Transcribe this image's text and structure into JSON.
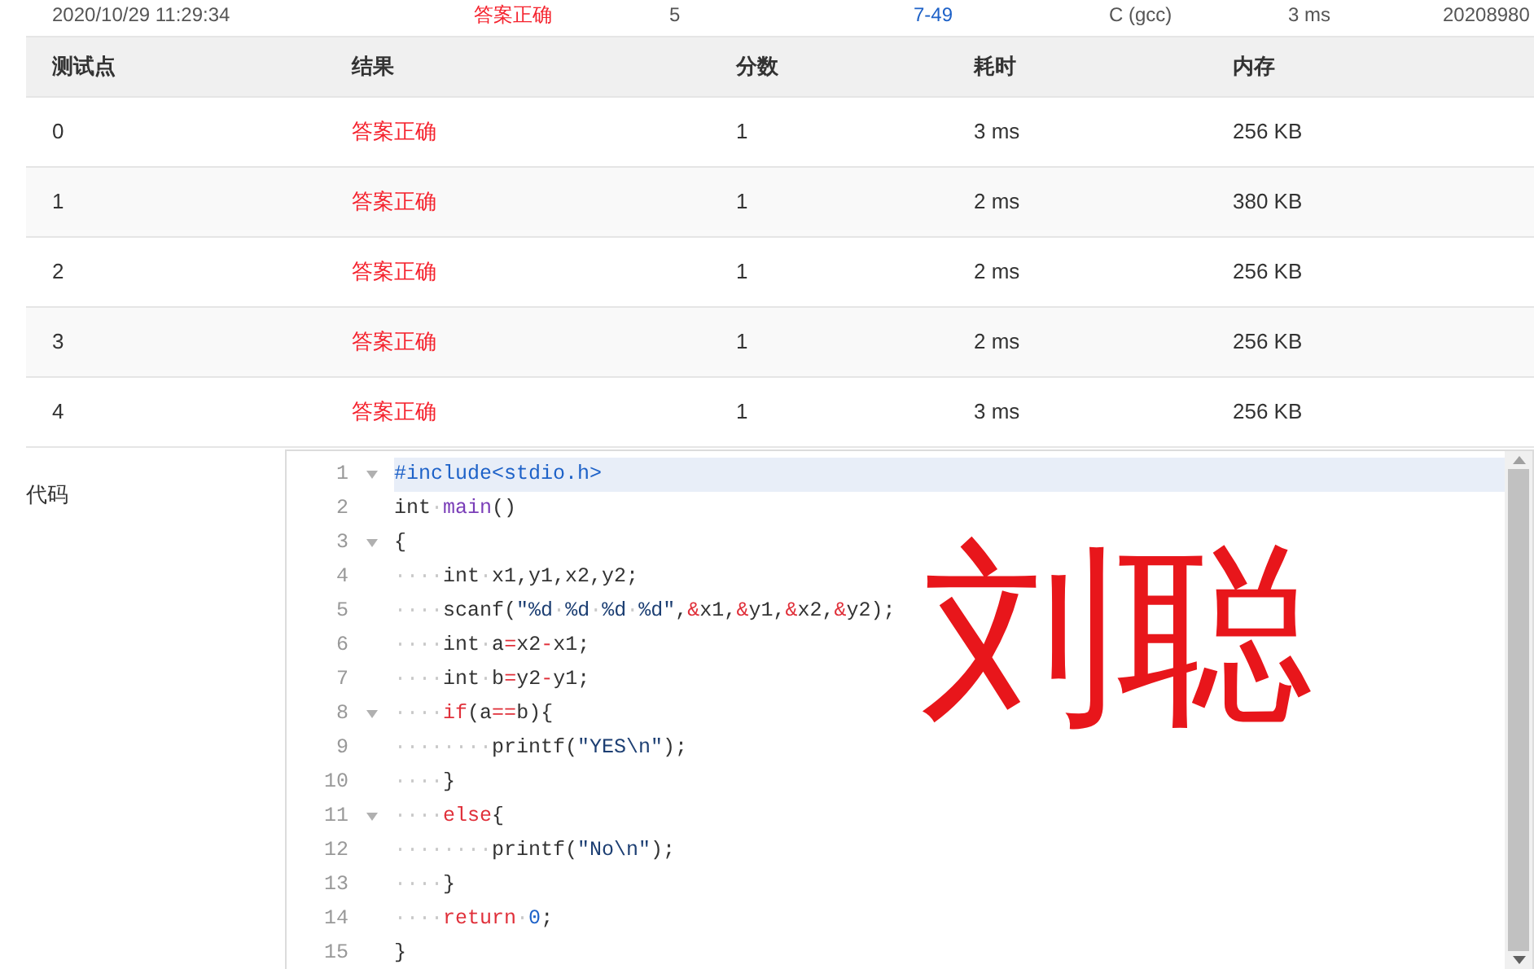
{
  "submission_row": {
    "time": "2020/10/29 11:29:34",
    "result": "答案正确",
    "score": "5",
    "problem": "7-49",
    "compiler": "C (gcc)",
    "duration": "3 ms",
    "user": "20208980"
  },
  "table": {
    "columns": [
      "测试点",
      "结果",
      "分数",
      "耗时",
      "内存"
    ],
    "rows": [
      {
        "case": "0",
        "result": "答案正确",
        "score": "1",
        "time": "3 ms",
        "memory": "256 KB"
      },
      {
        "case": "1",
        "result": "答案正确",
        "score": "1",
        "time": "2 ms",
        "memory": "380 KB"
      },
      {
        "case": "2",
        "result": "答案正确",
        "score": "1",
        "time": "2 ms",
        "memory": "256 KB"
      },
      {
        "case": "3",
        "result": "答案正确",
        "score": "1",
        "time": "2 ms",
        "memory": "256 KB"
      },
      {
        "case": "4",
        "result": "答案正确",
        "score": "1",
        "time": "3 ms",
        "memory": "256 KB"
      }
    ]
  },
  "code": {
    "label": "代码",
    "annotation": "刘聪",
    "lines": [
      {
        "number": "1",
        "fold": true,
        "current": true,
        "tokens": [
          {
            "kind": "meta",
            "text": "#include<stdio.h>"
          }
        ]
      },
      {
        "number": "2",
        "fold": false,
        "current": false,
        "tokens": [
          {
            "kind": "plain",
            "text": "int"
          },
          {
            "kind": "ws",
            "text": "·"
          },
          {
            "kind": "func",
            "text": "main"
          },
          {
            "kind": "plain",
            "text": "()"
          }
        ]
      },
      {
        "number": "3",
        "fold": true,
        "current": false,
        "tokens": [
          {
            "kind": "plain",
            "text": "{"
          }
        ]
      },
      {
        "number": "4",
        "fold": false,
        "current": false,
        "tokens": [
          {
            "kind": "ws",
            "text": "····"
          },
          {
            "kind": "plain",
            "text": "int"
          },
          {
            "kind": "ws",
            "text": "·"
          },
          {
            "kind": "plain",
            "text": "x1,y1,x2,y2;"
          }
        ]
      },
      {
        "number": "5",
        "fold": false,
        "current": false,
        "tokens": [
          {
            "kind": "ws",
            "text": "····"
          },
          {
            "kind": "plain",
            "text": "scanf("
          },
          {
            "kind": "string",
            "text": "\"%d"
          },
          {
            "kind": "ws",
            "text": "·"
          },
          {
            "kind": "string",
            "text": "%d"
          },
          {
            "kind": "ws",
            "text": "·"
          },
          {
            "kind": "string",
            "text": "%d"
          },
          {
            "kind": "ws",
            "text": "·"
          },
          {
            "kind": "string",
            "text": "%d\""
          },
          {
            "kind": "plain",
            "text": ","
          },
          {
            "kind": "op",
            "text": "&"
          },
          {
            "kind": "plain",
            "text": "x1,"
          },
          {
            "kind": "op",
            "text": "&"
          },
          {
            "kind": "plain",
            "text": "y1,"
          },
          {
            "kind": "op",
            "text": "&"
          },
          {
            "kind": "plain",
            "text": "x2,"
          },
          {
            "kind": "op",
            "text": "&"
          },
          {
            "kind": "plain",
            "text": "y2);"
          }
        ]
      },
      {
        "number": "6",
        "fold": false,
        "current": false,
        "tokens": [
          {
            "kind": "ws",
            "text": "····"
          },
          {
            "kind": "plain",
            "text": "int"
          },
          {
            "kind": "ws",
            "text": "·"
          },
          {
            "kind": "plain",
            "text": "a"
          },
          {
            "kind": "op",
            "text": "="
          },
          {
            "kind": "plain",
            "text": "x2"
          },
          {
            "kind": "op",
            "text": "-"
          },
          {
            "kind": "plain",
            "text": "x1;"
          }
        ]
      },
      {
        "number": "7",
        "fold": false,
        "current": false,
        "tokens": [
          {
            "kind": "ws",
            "text": "····"
          },
          {
            "kind": "plain",
            "text": "int"
          },
          {
            "kind": "ws",
            "text": "·"
          },
          {
            "kind": "plain",
            "text": "b"
          },
          {
            "kind": "op",
            "text": "="
          },
          {
            "kind": "plain",
            "text": "y2"
          },
          {
            "kind": "op",
            "text": "-"
          },
          {
            "kind": "plain",
            "text": "y1;"
          }
        ]
      },
      {
        "number": "8",
        "fold": true,
        "current": false,
        "tokens": [
          {
            "kind": "ws",
            "text": "····"
          },
          {
            "kind": "keyword",
            "text": "if"
          },
          {
            "kind": "plain",
            "text": "(a"
          },
          {
            "kind": "op",
            "text": "=="
          },
          {
            "kind": "plain",
            "text": "b){"
          }
        ]
      },
      {
        "number": "9",
        "fold": false,
        "current": false,
        "tokens": [
          {
            "kind": "ws",
            "text": "········"
          },
          {
            "kind": "plain",
            "text": "printf("
          },
          {
            "kind": "string",
            "text": "\"YES\\n\""
          },
          {
            "kind": "plain",
            "text": ");"
          }
        ]
      },
      {
        "number": "10",
        "fold": false,
        "current": false,
        "tokens": [
          {
            "kind": "ws",
            "text": "····"
          },
          {
            "kind": "plain",
            "text": "}"
          }
        ]
      },
      {
        "number": "11",
        "fold": true,
        "current": false,
        "tokens": [
          {
            "kind": "ws",
            "text": "····"
          },
          {
            "kind": "keyword",
            "text": "else"
          },
          {
            "kind": "plain",
            "text": "{"
          }
        ]
      },
      {
        "number": "12",
        "fold": false,
        "current": false,
        "tokens": [
          {
            "kind": "ws",
            "text": "········"
          },
          {
            "kind": "plain",
            "text": "printf("
          },
          {
            "kind": "string",
            "text": "\"No\\n\""
          },
          {
            "kind": "plain",
            "text": ");"
          }
        ]
      },
      {
        "number": "13",
        "fold": false,
        "current": false,
        "tokens": [
          {
            "kind": "ws",
            "text": "····"
          },
          {
            "kind": "plain",
            "text": "}"
          }
        ]
      },
      {
        "number": "14",
        "fold": false,
        "current": false,
        "tokens": [
          {
            "kind": "ws",
            "text": "····"
          },
          {
            "kind": "keyword",
            "text": "return"
          },
          {
            "kind": "ws",
            "text": "·"
          },
          {
            "kind": "number",
            "text": "0"
          },
          {
            "kind": "plain",
            "text": ";"
          }
        ]
      },
      {
        "number": "15",
        "fold": false,
        "current": false,
        "tokens": [
          {
            "kind": "plain",
            "text": "}"
          }
        ]
      }
    ]
  }
}
